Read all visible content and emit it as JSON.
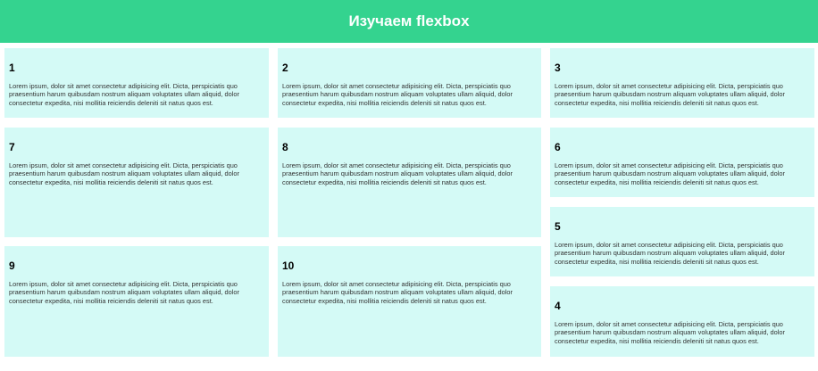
{
  "header": {
    "title": "Изучаем flexbox"
  },
  "cards": [
    {
      "number": "1",
      "text": "Lorem ipsum, dolor sit amet consectetur adipisicing elit. Dicta, perspiciatis quo praesentium harum quibusdam nostrum aliquam voluptates ullam aliquid, dolor consectetur expedita, nisi mollitia reiciendis deleniti sit natus quos est."
    },
    {
      "number": "2",
      "text": "Lorem ipsum, dolor sit amet consectetur adipisicing elit. Dicta, perspiciatis quo praesentium harum quibusdam nostrum aliquam voluptates ullam aliquid, dolor consectetur expedita, nisi mollitia reiciendis deleniti sit natus quos est."
    },
    {
      "number": "3",
      "text": "Lorem ipsum, dolor sit amet consectetur adipisicing elit. Dicta, perspiciatis quo praesentium harum quibusdam nostrum aliquam voluptates ullam aliquid, dolor consectetur expedita, nisi mollitia reiciendis deleniti sit natus quos est."
    },
    {
      "number": "7",
      "text": "Lorem ipsum, dolor sit amet consectetur adipisicing elit. Dicta, perspiciatis quo praesentium harum quibusdam nostrum aliquam voluptates ullam aliquid, dolor consectetur expedita, nisi mollitia reiciendis deleniti sit natus quos est."
    },
    {
      "number": "8",
      "text": "Lorem ipsum, dolor sit amet consectetur adipisicing elit. Dicta, perspiciatis quo praesentium harum quibusdam nostrum aliquam voluptates ullam aliquid, dolor consectetur expedita, nisi mollitia reiciendis deleniti sit natus quos est."
    },
    {
      "number": "6",
      "text": "Lorem ipsum, dolor sit amet consectetur adipisicing elit. Dicta, perspiciatis quo praesentium harum quibusdam nostrum aliquam voluptates ullam aliquid, dolor consectetur expedita, nisi mollitia reiciendis deleniti sit natus quos est."
    },
    {
      "number": "5",
      "text": "Lorem ipsum, dolor sit amet consectetur adipisicing elit. Dicta, perspiciatis quo praesentium harum quibusdam nostrum aliquam voluptates ullam aliquid, dolor consectetur expedita, nisi mollitia reiciendis deleniti sit natus quos est."
    },
    {
      "number": "9",
      "text": "Lorem ipsum, dolor sit amet consectetur adipisicing elit. Dicta, perspiciatis quo praesentium harum quibusdam nostrum aliquam voluptates ullam aliquid, dolor consectetur expedita, nisi mollitia reiciendis deleniti sit natus quos est."
    },
    {
      "number": "10",
      "text": "Lorem ipsum, dolor sit amet consectetur adipisicing elit. Dicta, perspiciatis quo praesentium harum quibusdam nostrum aliquam voluptates ullam aliquid, dolor consectetur expedita, nisi mollitia reiciendis deleniti sit natus quos est."
    },
    {
      "number": "4",
      "text": "Lorem ipsum, dolor sit amet consectetur adipisicing elit. Dicta, perspiciatis quo praesentium harum quibusdam nostrum aliquam voluptates ullam aliquid, dolor consectetur expedita, nisi mollitia reiciendis deleniti sit natus quos est."
    }
  ],
  "colors": {
    "header_bg": "#34d38f",
    "card_bg": "#d4faf6"
  }
}
